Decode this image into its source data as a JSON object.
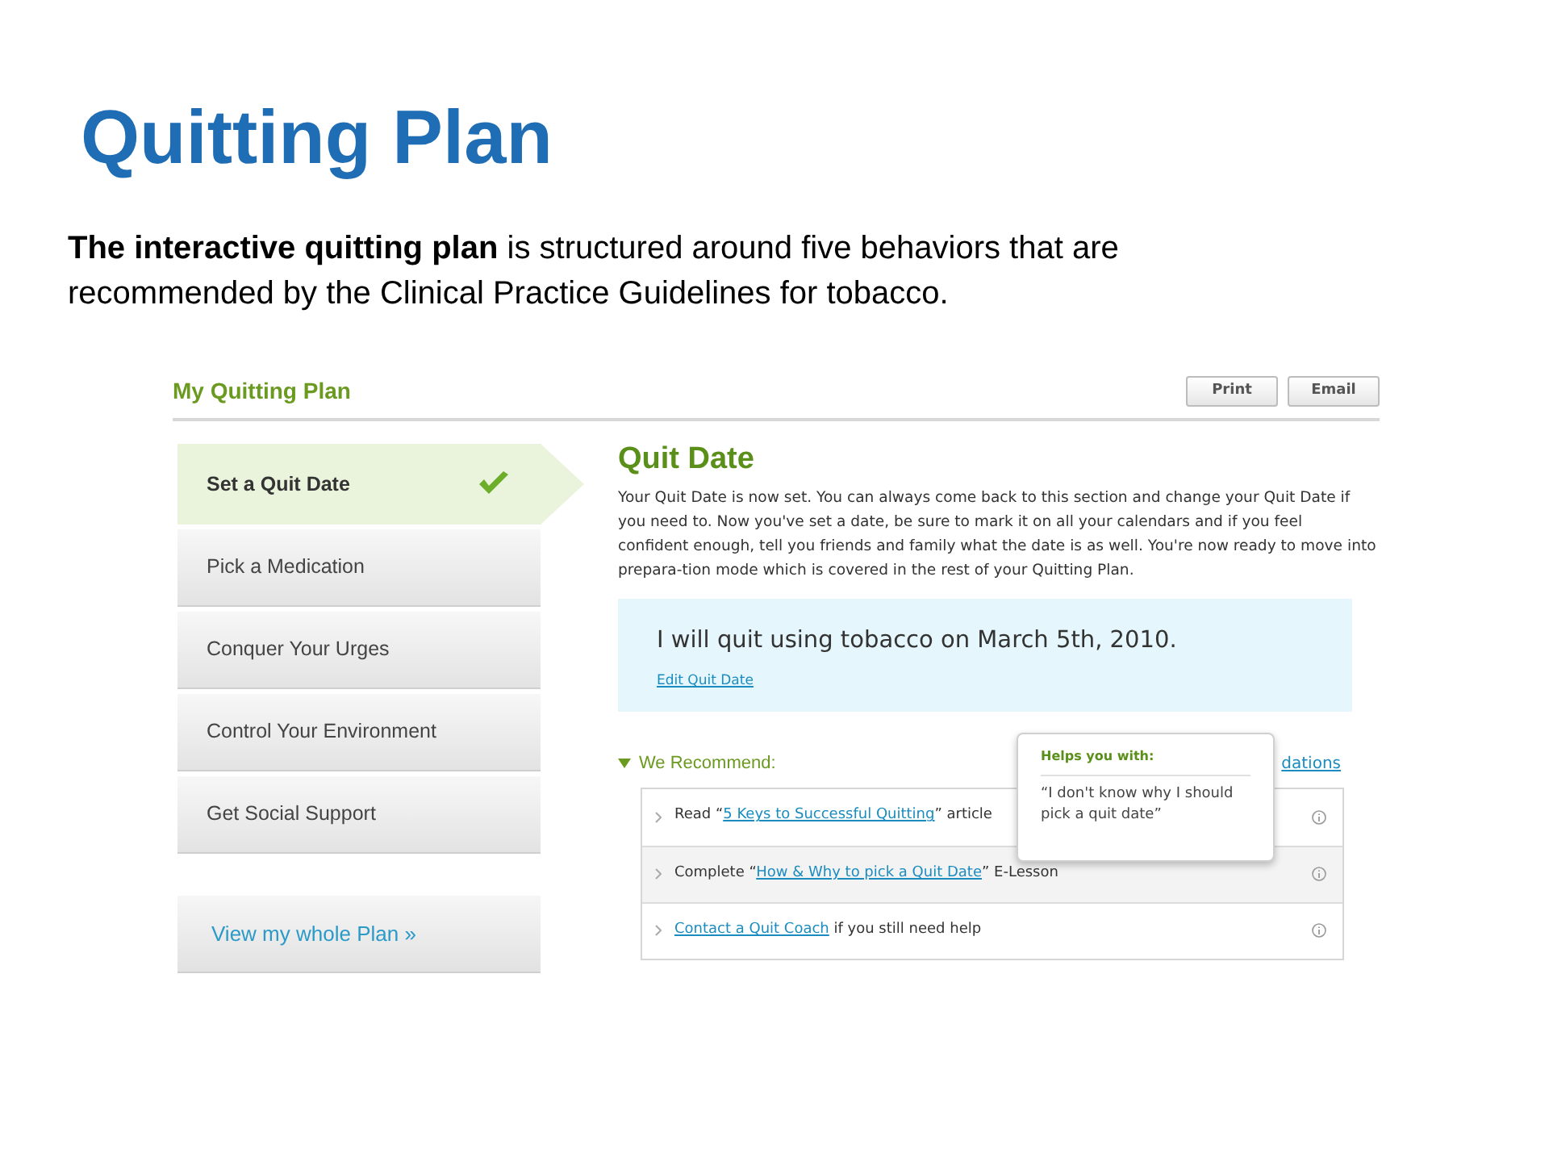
{
  "slide": {
    "title": "Quitting Plan",
    "intro": "**The interactive quitting plan** is structured around five behaviors that are recommended by the Clinical Practice Guidelines for tobacco."
  },
  "app": {
    "header_title": "My Quitting Plan",
    "buttons": [
      "Print",
      "Email"
    ],
    "steps": [
      {
        "label": "Set a Quit Date",
        "selected": true,
        "completed": true
      },
      {
        "label": "Pick a Medication",
        "selected": false,
        "completed": false
      },
      {
        "label": "Conquer Your Urges",
        "selected": false,
        "completed": false
      },
      {
        "label": "Control Your Environment",
        "selected": false,
        "completed": false
      },
      {
        "label": "Get Social Support",
        "selected": false,
        "completed": false
      }
    ],
    "view_plan_link": "View my whole Plan »",
    "section": {
      "title": "Quit Date",
      "body": "Your Quit Date is now set. You can always come back to this section and change your Quit Date if you need to. Now you've set a date, be sure to mark it on all your calendars and if you feel confident enough, tell you friends and family what the date is as well. You're now ready to move into prepara-tion mode which is covered in the rest of your Quitting Plan.",
      "quit_statement": "I will quit using tobacco on March 5th, 2010.",
      "edit_link": "Edit Quit Date"
    },
    "recommend": {
      "label": "We Recommend:",
      "expanded": true,
      "right_link": "dations",
      "items": [
        {
          "before": "Read “",
          "link": "5 Keys to Successful Quitting",
          "after": "” article",
          "highlighted": false
        },
        {
          "before": "Complete “",
          "link": "How & Why to pick a Quit Date",
          "after": "” E-Lesson",
          "highlighted": true
        },
        {
          "link": "Contact a Quit Coach",
          "after": " if you still need help",
          "highlighted": false
        }
      ]
    },
    "tooltip": {
      "title": "Helps you with:",
      "text": "“I don't know why I should pick a quit date”"
    }
  }
}
